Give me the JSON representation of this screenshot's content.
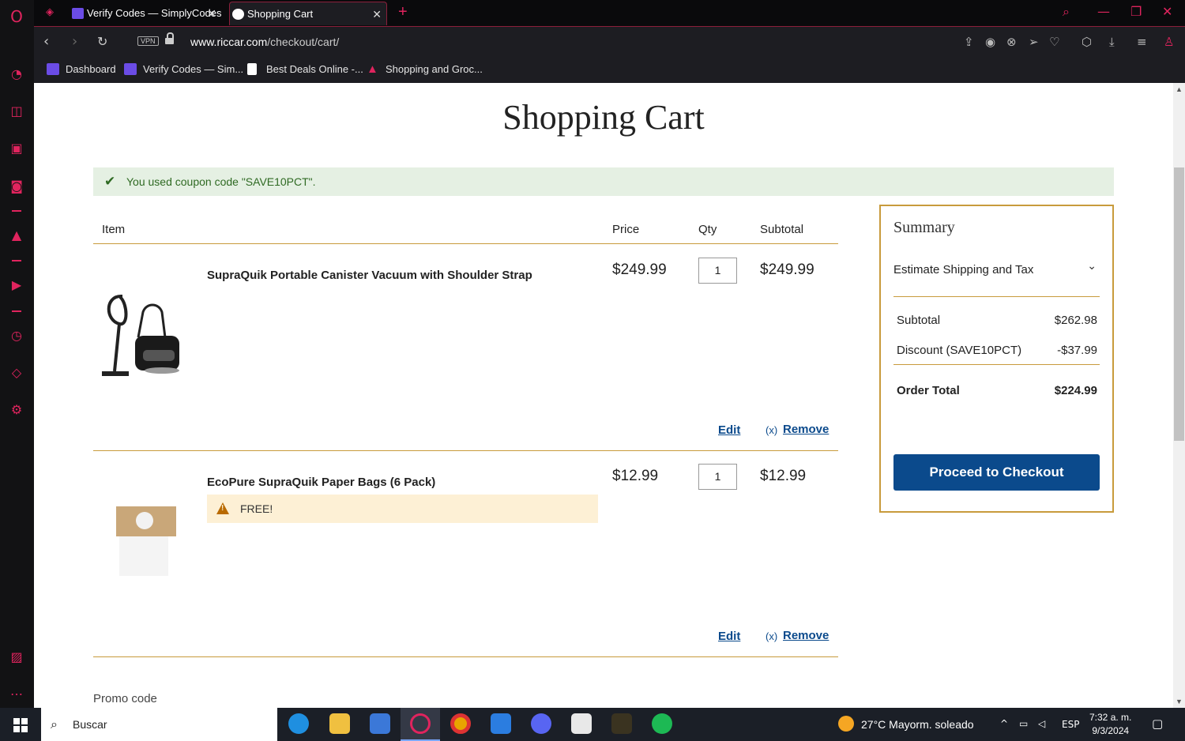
{
  "browser": {
    "tabs": [
      {
        "label": "Verify Codes — SimplyCodes"
      },
      {
        "label": "Shopping Cart"
      }
    ],
    "url_domain": "www.riccar.com",
    "url_path": "/checkout/cart/",
    "vpn_label": "VPN",
    "bookmarks": [
      {
        "label": "Dashboard"
      },
      {
        "label": "Verify Codes — Sim..."
      },
      {
        "label": "Best Deals Online -..."
      },
      {
        "label": "Shopping and Groc..."
      }
    ]
  },
  "page": {
    "title": "Shopping Cart",
    "coupon_message": "You used coupon code \"SAVE10PCT\".",
    "table_headers": {
      "item": "Item",
      "price": "Price",
      "qty": "Qty",
      "subtotal": "Subtotal"
    },
    "items": [
      {
        "name": "SupraQuik Portable Canister Vacuum with Shoulder Strap",
        "price": "$249.99",
        "qty": "1",
        "subtotal": "$249.99",
        "edit": "Edit",
        "remove_x": "(x)",
        "remove": "Remove"
      },
      {
        "name": "EcoPure SupraQuik Paper Bags (6 Pack)",
        "price": "$12.99",
        "qty": "1",
        "subtotal": "$12.99",
        "badge": "FREE!",
        "edit": "Edit",
        "remove_x": "(x)",
        "remove": "Remove"
      }
    ],
    "promo_label": "Promo code"
  },
  "summary": {
    "title": "Summary",
    "shipping_label": "Estimate Shipping and Tax",
    "subtotal_label": "Subtotal",
    "subtotal_value": "$262.98",
    "discount_label": "Discount (SAVE10PCT)",
    "discount_value": "-$37.99",
    "total_label": "Order Total",
    "total_value": "$224.99",
    "checkout_label": "Proceed to Checkout"
  },
  "taskbar": {
    "search_placeholder": "Buscar",
    "weather": "27°C  Mayorm. soleado",
    "lang": "ESP",
    "time": "7:32 a. m.",
    "date": "9/3/2024"
  }
}
